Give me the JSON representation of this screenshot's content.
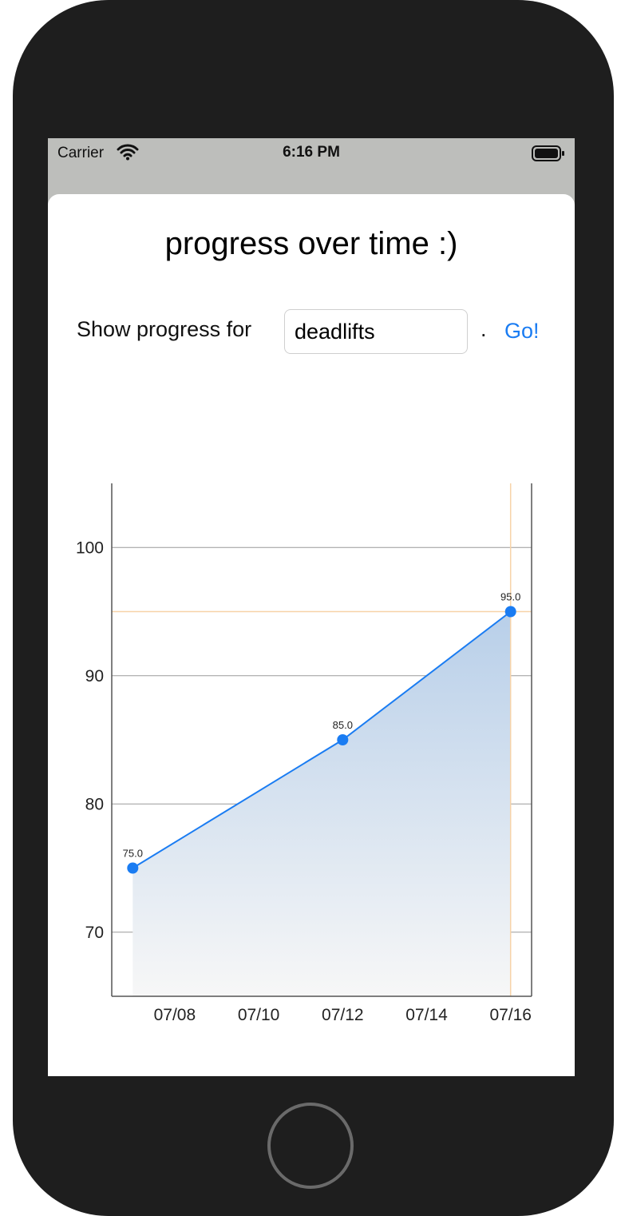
{
  "status_bar": {
    "carrier": "Carrier",
    "time": "6:16 PM"
  },
  "page": {
    "title": "progress over time :)",
    "prompt_label": "Show progress for",
    "exercise_value": "deadlifts",
    "period": ".",
    "go_label": "Go!"
  },
  "colors": {
    "accent": "#1a7cf2",
    "highlight": "#f7d3a8",
    "fill_top": "#b8cfe9"
  },
  "chart_data": {
    "type": "line",
    "x": [
      "07/07",
      "07/12",
      "07/16"
    ],
    "values": [
      75.0,
      85.0,
      95.0
    ],
    "point_labels": [
      "75.0",
      "85.0",
      "95.0"
    ],
    "x_ticks": [
      "07/08",
      "07/10",
      "07/12",
      "07/14",
      "07/16"
    ],
    "y_ticks": [
      70,
      80,
      90,
      100
    ],
    "xlim": [
      "07/06.5",
      "07/16.5"
    ],
    "ylim": [
      65,
      105
    ],
    "highlight": {
      "x": "07/16",
      "y": 95.0
    },
    "grid": true,
    "fill": "gradient"
  }
}
